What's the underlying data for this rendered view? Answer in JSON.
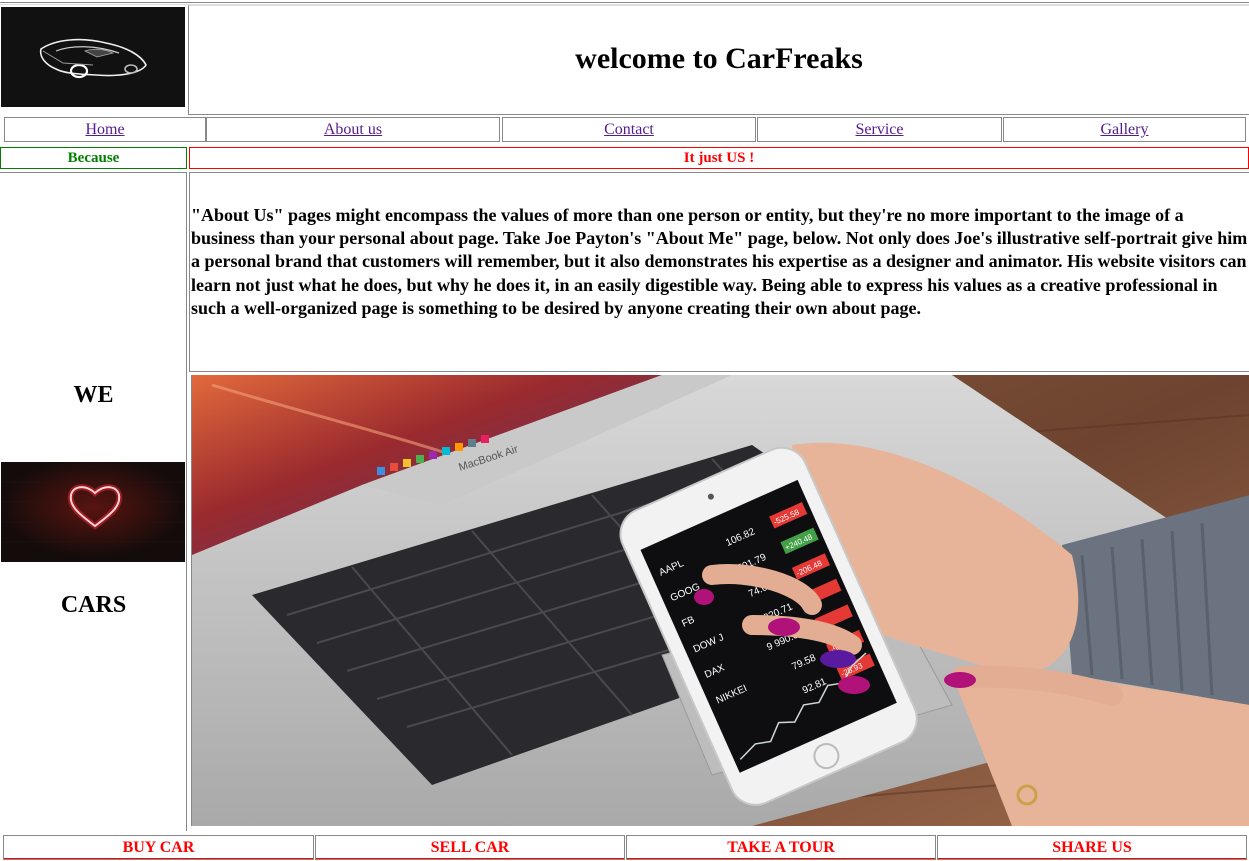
{
  "header": {
    "logo_icon": "car-logo-icon",
    "title": "welcome to CarFreaks"
  },
  "nav": {
    "items": [
      {
        "label": "Home"
      },
      {
        "label": "About us"
      },
      {
        "label": "Contact"
      },
      {
        "label": "Service"
      },
      {
        "label": "Gallery"
      }
    ]
  },
  "tagline": {
    "left": "Because",
    "right": "It just US !",
    "left_color": "#008000",
    "right_color": "#ff0000"
  },
  "sidebar": {
    "word_top": "WE",
    "heart_icon": "neon-heart-icon",
    "word_bottom": "CARS"
  },
  "main": {
    "about_text": "\"About Us\" pages might encompass the values of more than one person or entity, but they're no more important to the image of a business than your personal about page. Take Joe Payton's \"About Me\" page, below. Not only does Joe's illustrative self-portrait give him a personal brand that customers will remember, but it also demonstrates his expertise as a designer and animator. His website visitors can learn not just what he does, but why he does it, in an easily digestible way. Being able to express his values as a creative professional in such a well-organized page is something to be desired by anyone creating their own about page.",
    "photo": {
      "laptop_label": "MacBook Air",
      "stocks": [
        {
          "symbol": "AAPL",
          "price": "106.82",
          "change": "-525.58"
        },
        {
          "symbol": "GOOG",
          "price": "501.79",
          "change": "+240.48"
        },
        {
          "symbol": "FB",
          "price": "74.05",
          "change": "-206.48"
        },
        {
          "symbol": "DOW J",
          "price": "17 320.71",
          "change": "-"
        },
        {
          "symbol": "DAX",
          "price": "9 990.09",
          "change": "-"
        },
        {
          "symbol": "NIKKEI",
          "price": "79.58",
          "change": "-58.55"
        },
        {
          "symbol": "",
          "price": "92.81",
          "change": "-25.93"
        }
      ]
    }
  },
  "footer": {
    "items": [
      {
        "label": "BUY CAR"
      },
      {
        "label": "SELL CAR"
      },
      {
        "label": "TAKE A TOUR"
      },
      {
        "label": "SHARE US"
      }
    ],
    "color": "#ff0000"
  }
}
